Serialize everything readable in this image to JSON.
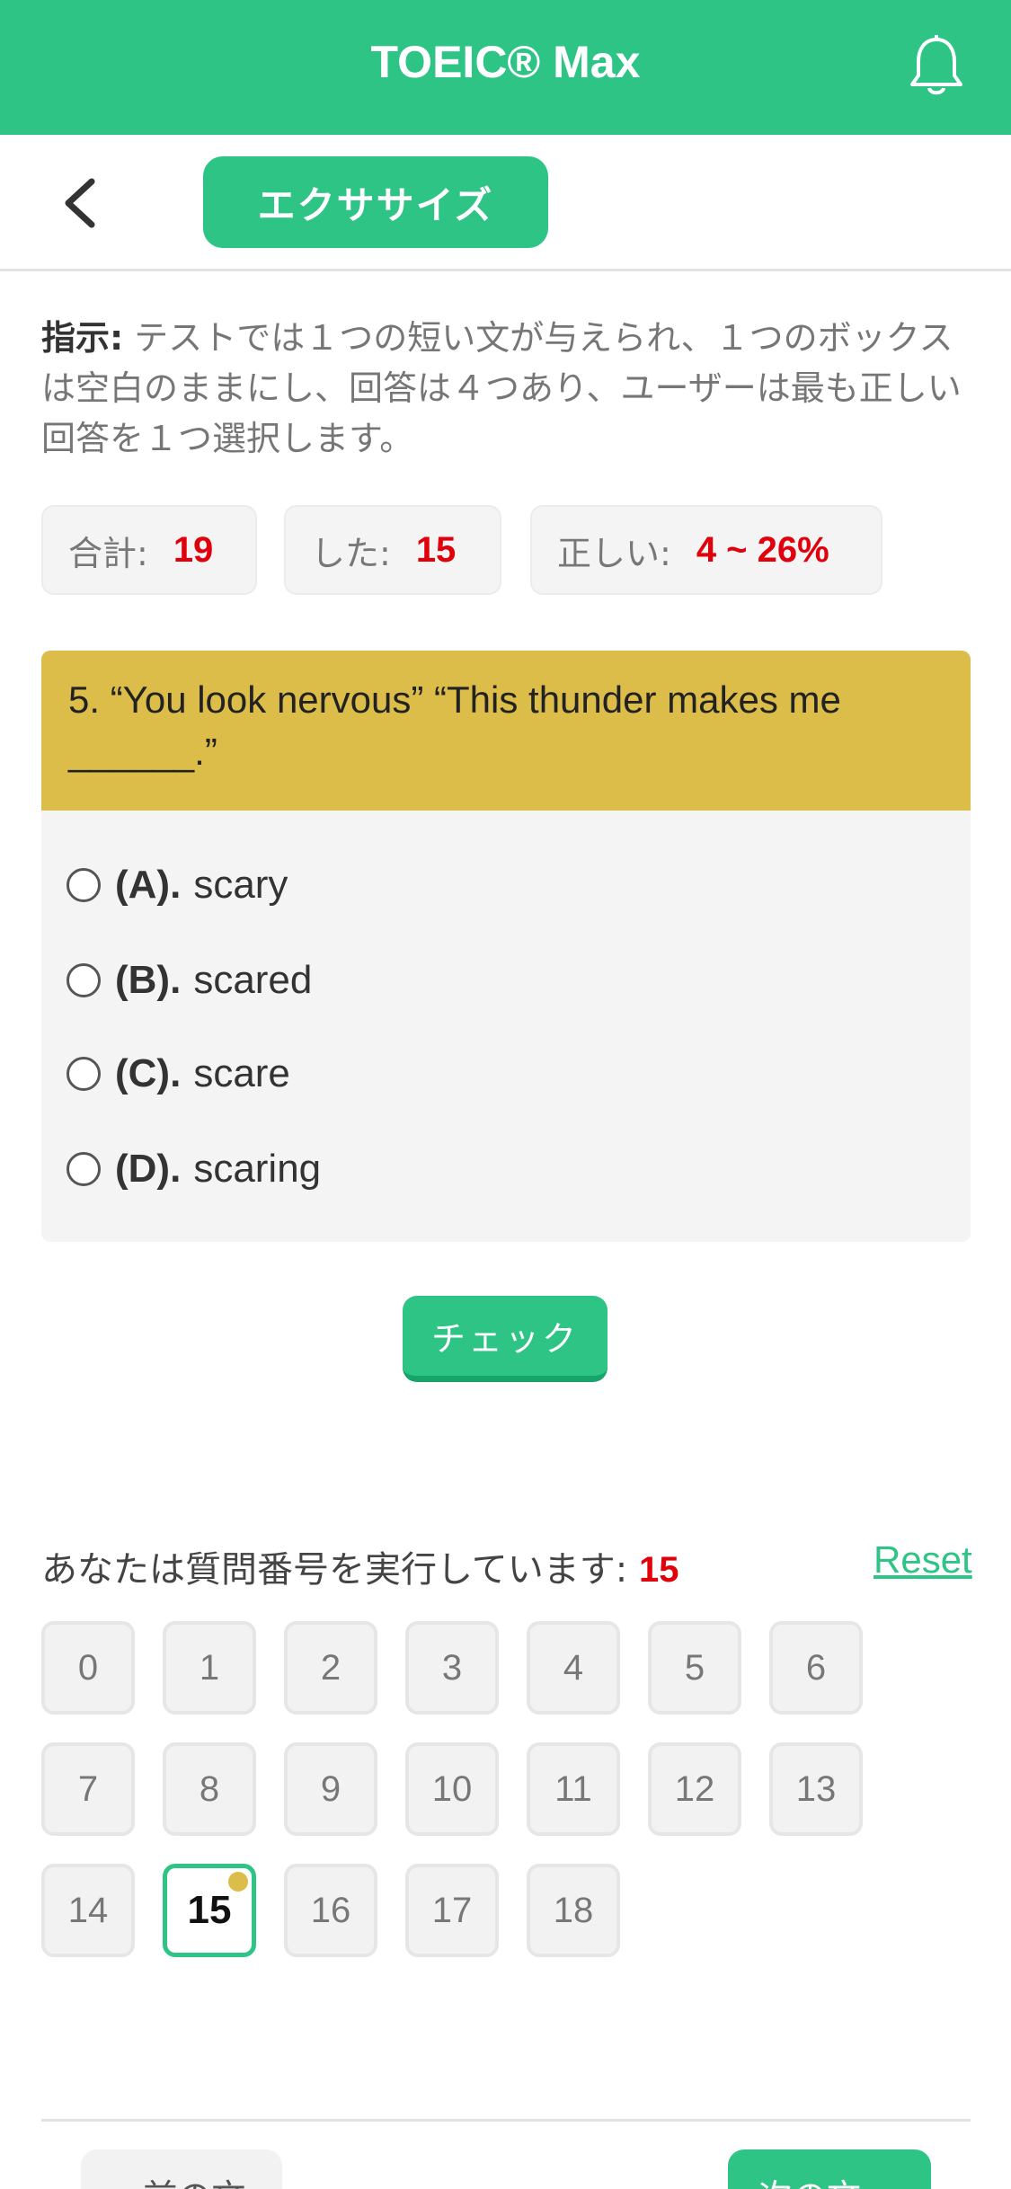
{
  "app": {
    "title": "TOEIC® Max",
    "icons": {
      "notifications": "bell-icon",
      "back": "chevron-left-icon"
    }
  },
  "subheader": {
    "section_label": "エクササイズ"
  },
  "instructions": {
    "label": "指示:",
    "text": " テストでは１つの短い文が与えられ、１つのボックスは空白のままにし、回答は４つあり、ユーザーは最も正しい回答を１つ選択します。"
  },
  "stats": {
    "total_label": "合計:",
    "total_value": "19",
    "done_label": "した:",
    "done_value": "15",
    "correct_label": "正しい:",
    "correct_value": "4 ~ 26%"
  },
  "question": {
    "text": "5. “You look nervous” “This thunder makes me ______.”",
    "options": [
      {
        "letter": "(A).",
        "text": "scary"
      },
      {
        "letter": "(B).",
        "text": "scared"
      },
      {
        "letter": "(C).",
        "text": "scare"
      },
      {
        "letter": "(D).",
        "text": "scaring"
      }
    ]
  },
  "check_button": "チェック",
  "progress": {
    "label": "あなたは質問番号を実行しています:",
    "current": "15",
    "reset_label": "Reset",
    "numbers": [
      "0",
      "1",
      "2",
      "3",
      "4",
      "5",
      "6",
      "7",
      "8",
      "9",
      "10",
      "11",
      "12",
      "13",
      "14",
      "15",
      "16",
      "17",
      "18"
    ]
  },
  "nav": {
    "prev_label": "« 前の文",
    "next_label": "次の文 »"
  },
  "colors": {
    "primary": "#2ec486",
    "question_header": "#dcbd4a",
    "highlight_red": "#e0000b"
  }
}
